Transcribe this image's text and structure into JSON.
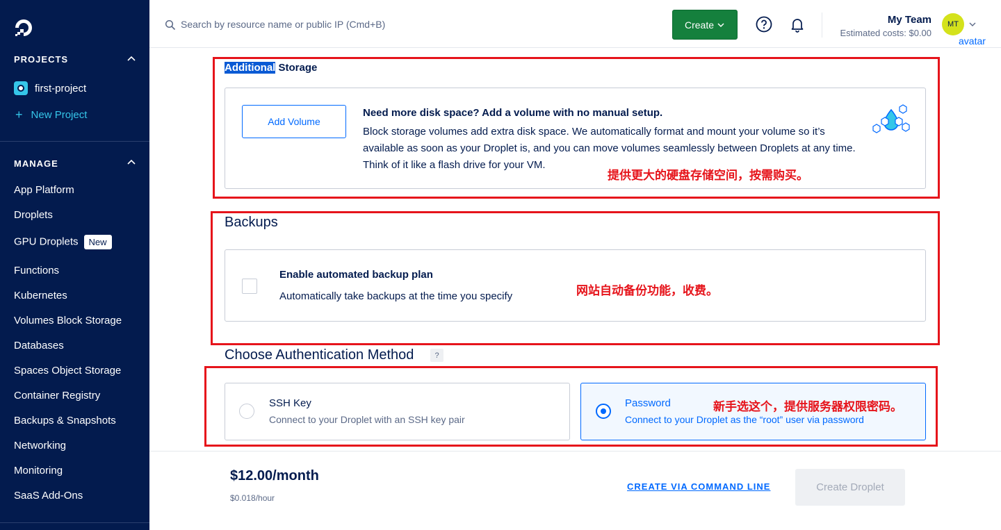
{
  "sidebar": {
    "projects_heading": "PROJECTS",
    "project_name": "first-project",
    "new_project": "New Project",
    "manage_heading": "MANAGE",
    "items": [
      {
        "label": "App Platform"
      },
      {
        "label": "Droplets"
      },
      {
        "label": "GPU Droplets",
        "badge": "New"
      },
      {
        "label": "Functions"
      },
      {
        "label": "Kubernetes"
      },
      {
        "label": "Volumes Block Storage"
      },
      {
        "label": "Databases"
      },
      {
        "label": "Spaces Object Storage"
      },
      {
        "label": "Container Registry"
      },
      {
        "label": "Backups & Snapshots"
      },
      {
        "label": "Networking"
      },
      {
        "label": "Monitoring"
      },
      {
        "label": "SaaS Add-Ons"
      }
    ]
  },
  "header": {
    "search_placeholder": "Search by resource name or public IP (Cmd+B)",
    "create_label": "Create",
    "team_name": "My Team",
    "estimated_costs": "Estimated costs: $0.00",
    "avatar_initials": "MT",
    "avatar_label": "avatar"
  },
  "storage": {
    "title_highlight": "Additional",
    "title_rest": " Storage",
    "add_volume": "Add Volume",
    "heading": "Need more disk space? Add a volume with no manual setup.",
    "body": "Block storage volumes add extra disk space. We automatically format and mount your volume so it’s available as soon as your Droplet is, and you can move volumes seamlessly between Droplets at any time. Think of it like a flash drive for your VM.",
    "annotation": "提供更大的硬盘存储空间，按需购买。"
  },
  "backups": {
    "title": "Backups",
    "heading": "Enable automated backup plan",
    "sub": "Automatically take backups at the time you specify",
    "annotation": "网站自动备份功能，收费。"
  },
  "auth": {
    "title": "Choose Authentication Method",
    "help": "?",
    "ssh_title": "SSH Key",
    "ssh_sub": "Connect to your Droplet with an SSH key pair",
    "pw_title": "Password",
    "pw_sub": "Connect to your Droplet as the “root” user via password",
    "annotation": "新手选这个，提供服务器权限密码。",
    "selected": "password"
  },
  "footer": {
    "price": "$12.00/month",
    "price_hourly": "$0.018/hour",
    "cli_link": "CREATE VIA COMMAND LINE",
    "create_droplet": "Create Droplet"
  },
  "colors": {
    "sidebar_bg": "#031b4e",
    "accent": "#0069ff",
    "create_green": "#15803d",
    "annotation_red": "#e6141b"
  }
}
